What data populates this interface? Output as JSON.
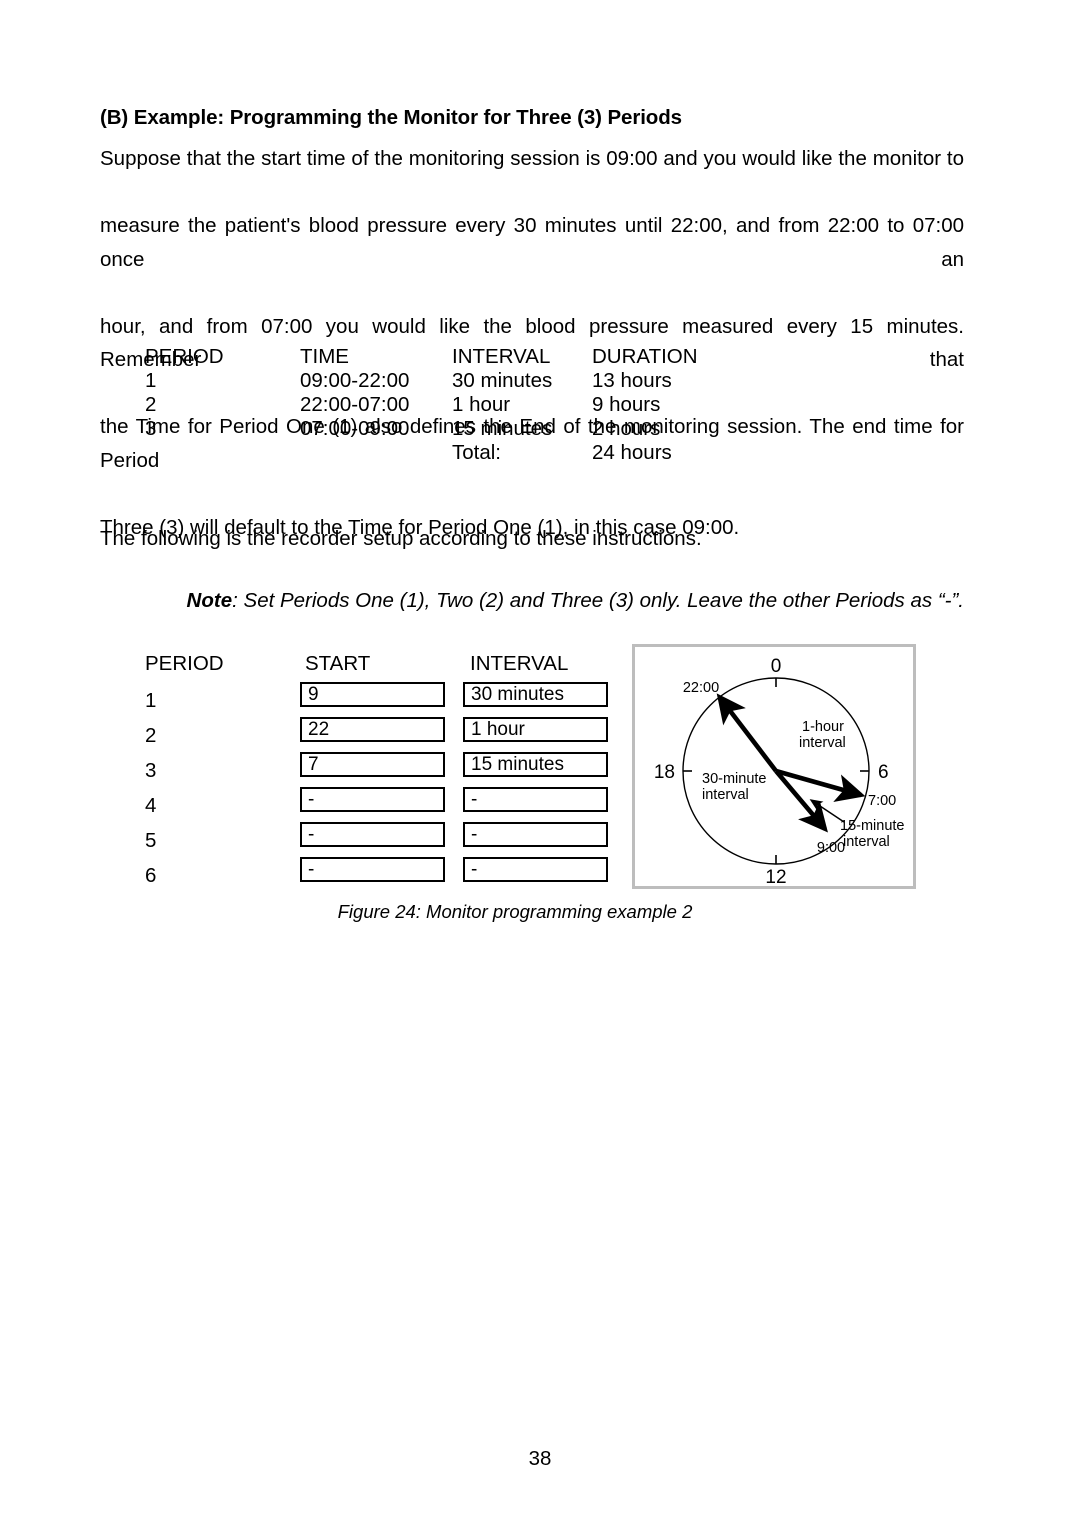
{
  "document": {
    "page_number": "38",
    "heading": "(B) Example: Programming the Monitor for Three (3) Periods",
    "intro_lines": [
      "Suppose that the start time of the monitoring session is 09:00 and you would like the monitor to",
      "measure the patient's blood pressure every 30 minutes until 22:00, and from 22:00 to 07:00 once an",
      "hour, and from 07:00 you would like the blood pressure measured every 15 minutes. Remember that",
      "the Time for Period One (1) also defines the End of the monitoring session. The end time for Period",
      "Three (3) will default to the Time for Period One (1), in this case 09:00."
    ],
    "setup_sentence": "The following is the recorder setup according to these instructions.",
    "note": {
      "label": "Note",
      "separator": ":",
      "text": "Set Periods One (1), Two (2) and Three (3) only. Leave the other Periods as “-”."
    },
    "caption": "Figure 24: Monitor programming example 2"
  },
  "summary_table": {
    "headers": {
      "period": "PERIOD",
      "time": "TIME",
      "interval": "INTERVAL",
      "duration": "DURATION"
    },
    "rows": [
      {
        "period": "1",
        "time": "09:00-22:00",
        "interval": "30 minutes",
        "duration": "13 hours"
      },
      {
        "period": "2",
        "time": "22:00-07:00",
        "interval": "1 hour",
        "duration": "9 hours"
      },
      {
        "period": "3",
        "time": "07:00-09:00",
        "interval": "15 minutes",
        "duration": "2 hours"
      }
    ],
    "total_row": {
      "period": "",
      "time": "",
      "interval": "Total:",
      "duration": "24 hours"
    }
  },
  "form_table": {
    "headers": {
      "period": "PERIOD",
      "start": "START",
      "interval": "INTERVAL"
    },
    "rows": [
      {
        "period": "1",
        "start": "9",
        "interval": "30 minutes"
      },
      {
        "period": "2",
        "start": "22",
        "interval": "1 hour"
      },
      {
        "period": "3",
        "start": "7",
        "interval": "15 minutes"
      },
      {
        "period": "4",
        "start": "-",
        "interval": "-"
      },
      {
        "period": "5",
        "start": "-",
        "interval": "-"
      },
      {
        "period": "6",
        "start": "-",
        "interval": "-"
      }
    ]
  },
  "clock_figure": {
    "hour_marks": {
      "top": "0",
      "right": "6",
      "bottom": "12",
      "left": "18"
    },
    "time_labels": {
      "label_2200": "22:00",
      "label_0700": "7:00",
      "label_0900": "9:00"
    },
    "interval_labels": {
      "one_hour_line1": "1-hour",
      "one_hour_line2": "interval",
      "thirty_minute_line1": "30-minute",
      "thirty_minute_line2": "interval",
      "fifteen_minute_line1": "15-minute",
      "fifteen_minute_line2": "interval"
    },
    "frame_color": "#bdbdbd",
    "stroke_color": "#000000"
  }
}
